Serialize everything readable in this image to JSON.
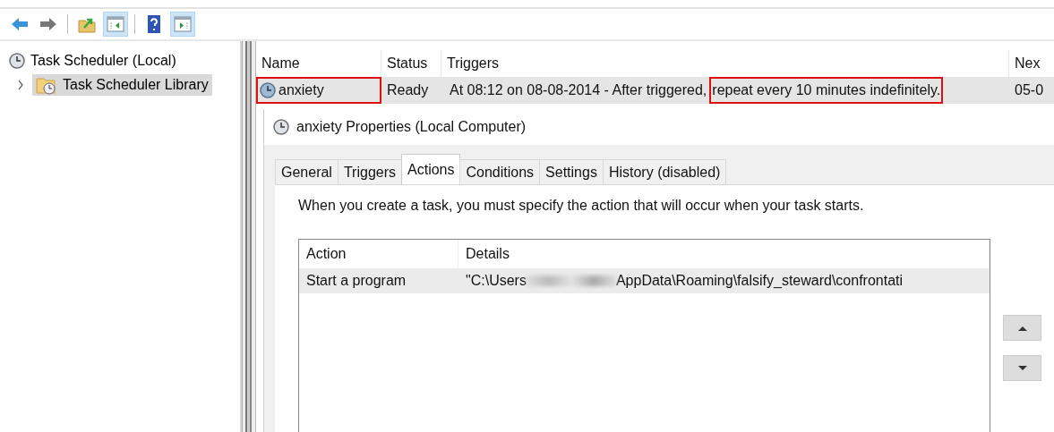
{
  "toolbar": [
    {
      "kind": "back",
      "pressed": false
    },
    {
      "kind": "forward",
      "pressed": false
    },
    {
      "kind": "separator"
    },
    {
      "kind": "folder-up",
      "pressed": false
    },
    {
      "kind": "show-tree",
      "pressed": true
    },
    {
      "kind": "separator"
    },
    {
      "kind": "help",
      "pressed": false
    },
    {
      "kind": "show-actions",
      "pressed": true
    }
  ],
  "tree": {
    "items": [
      {
        "label": "Task Scheduler (Local)",
        "selected": false,
        "children": [
          {
            "label": "Task Scheduler Library",
            "selected": true,
            "expanded": false
          }
        ]
      }
    ]
  },
  "task_list": {
    "columns": [
      "Name",
      "Status",
      "Triggers",
      "Nex"
    ],
    "rows": [
      {
        "name": "anxiety",
        "name_highlighted": true,
        "status": "Ready",
        "triggers": [
          {
            "text": "At 08:12 on 08-08-2014 - After triggered,",
            "highlighted": false
          },
          {
            "text": "repeat every 10 minutes indefinitely.",
            "highlighted": true
          }
        ],
        "next": "05-0",
        "selected": true
      }
    ]
  },
  "properties": {
    "title": "anxiety Properties (Local Computer)",
    "tabs": [
      {
        "label": "General",
        "selected": false
      },
      {
        "label": "Triggers",
        "selected": false
      },
      {
        "label": "Actions",
        "selected": true
      },
      {
        "label": "Conditions",
        "selected": false
      },
      {
        "label": "Settings",
        "selected": false
      },
      {
        "label": "History (disabled)",
        "selected": false
      }
    ],
    "description": "When you create a task, you must specify the action that will occur when your task starts.",
    "actions": {
      "columns": [
        "Action",
        "Details"
      ],
      "rows": [
        {
          "action": "Start a program",
          "details_start": "\"C:\\Users",
          "details_redacted": true,
          "details_end": "AppData\\Roaming\\falsify_steward\\confrontati",
          "selected": true
        }
      ]
    }
  }
}
